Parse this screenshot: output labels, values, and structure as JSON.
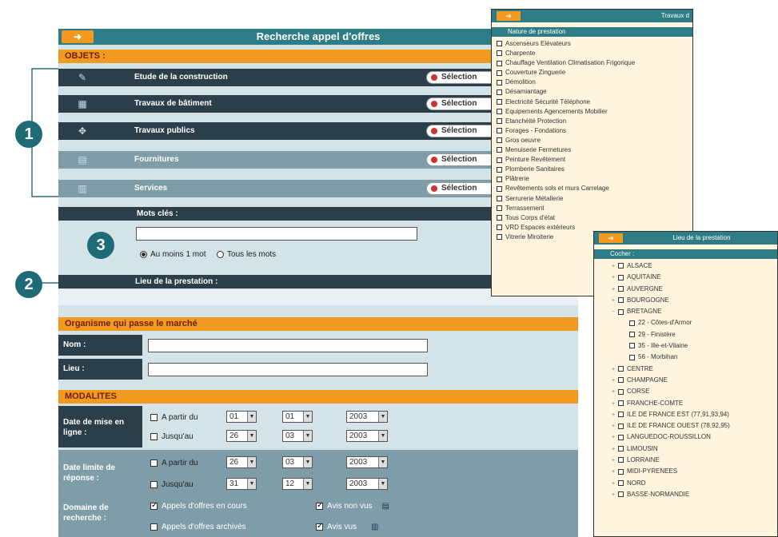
{
  "window": {
    "arrow": "➜",
    "title": "Recherche appel d'offres"
  },
  "objets": {
    "header": "OBJETS :",
    "select_label": "Sélection",
    "items": [
      {
        "label": "Etude de la construction",
        "icon": "pencil-icon",
        "glyph": "✎"
      },
      {
        "label": "Travaux de bâtiment",
        "icon": "building-icon",
        "glyph": "▦"
      },
      {
        "label": "Travaux publics",
        "icon": "road-icon",
        "glyph": "✥"
      },
      {
        "label": "Fournitures",
        "icon": "supplies-icon",
        "glyph": "▤"
      },
      {
        "label": "Services",
        "icon": "services-icon",
        "glyph": "▥"
      }
    ]
  },
  "keywords": {
    "label": "Mots clés :",
    "value": "",
    "option_any": "Au moins 1 mot",
    "option_all": "Tous les mots"
  },
  "lieu": {
    "label": "Lieu de la prestation :"
  },
  "organisme": {
    "header": "Organisme qui passe le marché",
    "nom_label": "Nom :",
    "lieu_label": "Lieu :",
    "nom_value": "",
    "lieu_value": ""
  },
  "modalites": {
    "header": "MODALITES",
    "date_online": {
      "label": "Date de mise en ligne :",
      "rows": [
        {
          "check": "A partir du",
          "day": "01",
          "month": "01",
          "year": "2003"
        },
        {
          "check": "Jusqu'au",
          "day": "26",
          "month": "03",
          "year": "2003"
        }
      ]
    },
    "date_limit": {
      "label": "Date limite de réponse :",
      "rows": [
        {
          "check": "A partir du",
          "day": "26",
          "month": "03",
          "year": "2003"
        },
        {
          "check": "Jusqu'au",
          "day": "31",
          "month": "12",
          "year": "2003"
        }
      ]
    },
    "domaine": {
      "label": "Domaine de recherche :",
      "opt1": "Appels d'offres en cours",
      "opt2": "Appels d'offres archivés",
      "opt3": "Avis non vus",
      "opt4": "Avis vus"
    }
  },
  "markers": {
    "m1": "1",
    "m2": "2",
    "m3": "3"
  },
  "popup_nature": {
    "title": "Travaux d",
    "column": "Nature de prestation",
    "items": [
      "Ascenseurs Elévateurs",
      "Charpente",
      "Chauffage Ventilation Climatisation Frigorique",
      "Couverture Zinguerie",
      "Démolition",
      "Désamiantage",
      "Electricité Sécurité Téléphone",
      "Equipements Agencements Mobilier",
      "Etanchéité Protection",
      "Forages - Fondations",
      "Gros oeuvre",
      "Menuiserie Fermetures",
      "Peinture Revêtement",
      "Plomberie Sanitaires",
      "Plâtrerie",
      "Revêtements sols et murs Carrelage",
      "Serrurerie Métallerie",
      "Terrassement",
      "Tous Corps d'état",
      "VRD Espaces extérieurs",
      "Vitrerie Miroiterie"
    ]
  },
  "popup_lieu": {
    "title": "Lieu de la prestation",
    "column": "Cocher :",
    "items": [
      {
        "label": "ALSACE",
        "child": false,
        "exp": "+"
      },
      {
        "label": "AQUITAINE",
        "child": false,
        "exp": "+"
      },
      {
        "label": "AUVERGNE",
        "child": false,
        "exp": "+"
      },
      {
        "label": "BOURGOGNE",
        "child": false,
        "exp": "+"
      },
      {
        "label": "BRETAGNE",
        "child": false,
        "exp": "−"
      },
      {
        "label": "22 - Côtes-d'Armor",
        "child": true,
        "exp": ""
      },
      {
        "label": "29 - Finistère",
        "child": true,
        "exp": ""
      },
      {
        "label": "35 - Ille-et-Vilaine",
        "child": true,
        "exp": ""
      },
      {
        "label": "56 - Morbihan",
        "child": true,
        "exp": ""
      },
      {
        "label": "CENTRE",
        "child": false,
        "exp": "+"
      },
      {
        "label": "CHAMPAGNE",
        "child": false,
        "exp": "+"
      },
      {
        "label": "CORSE",
        "child": false,
        "exp": "+"
      },
      {
        "label": "FRANCHE-COMTE",
        "child": false,
        "exp": "+"
      },
      {
        "label": "ILE DE FRANCE EST (77,91,93,94)",
        "child": false,
        "exp": "+"
      },
      {
        "label": "ILE DE FRANCE OUEST (78,92,95)",
        "child": false,
        "exp": "+"
      },
      {
        "label": "LANGUEDOC-ROUSSILLON",
        "child": false,
        "exp": "+"
      },
      {
        "label": "LIMOUSIN",
        "child": false,
        "exp": "+"
      },
      {
        "label": "LORRAINE",
        "child": false,
        "exp": "+"
      },
      {
        "label": "MIDI-PYRENEES",
        "child": false,
        "exp": "+"
      },
      {
        "label": "NORD",
        "child": false,
        "exp": "+"
      },
      {
        "label": "BASSE-NORMANDIE",
        "child": false,
        "exp": "+"
      }
    ]
  }
}
